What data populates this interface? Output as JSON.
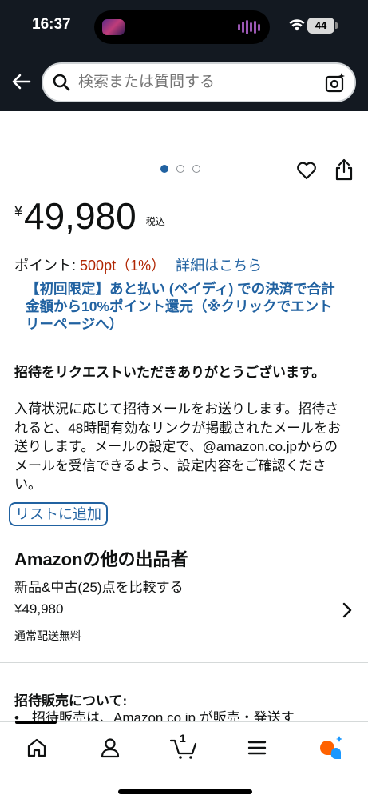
{
  "status_bar": {
    "time": "16:37",
    "battery": "44"
  },
  "header": {
    "search_placeholder": "検索または質問する"
  },
  "carousel": {
    "total": 3,
    "active": 1
  },
  "product": {
    "price_symbol": "¥",
    "price": "49,980",
    "tax_label": "税込",
    "points_label": "ポイント:",
    "points_value": "500pt（1%）",
    "points_link": "詳細はこちら",
    "promo_text": "【初回限定】あと払い (ペイディ) での決済で合計金額から10%ポイント還元（※クリックでエントリーページへ）"
  },
  "invite": {
    "title": "招待をリクエストいただきありがとうございます。",
    "body": "入荷状況に応じて招待メールをお送りします。招待されると、48時間有効なリンクが掲載されたメールをお送りします。メールの設定で、@amazon.co.jpからのメールを受信できるよう、設定内容をご確認ください。",
    "add_to_list": "リストに追加"
  },
  "other_sellers": {
    "title": "Amazonの他の出品者",
    "compare": "新品&中古(25)点を比較する",
    "price": "¥49,980",
    "shipping": "通常配送無料"
  },
  "invite_sales": {
    "title": "招待販売について:",
    "bullet": "招待販売は、Amazon.co.jp が販売・発送す"
  },
  "bottom_nav": {
    "cart_count": "1"
  },
  "colors": {
    "header_bg": "#131921",
    "link": "#2162a1",
    "price_accent": "#b12704"
  }
}
